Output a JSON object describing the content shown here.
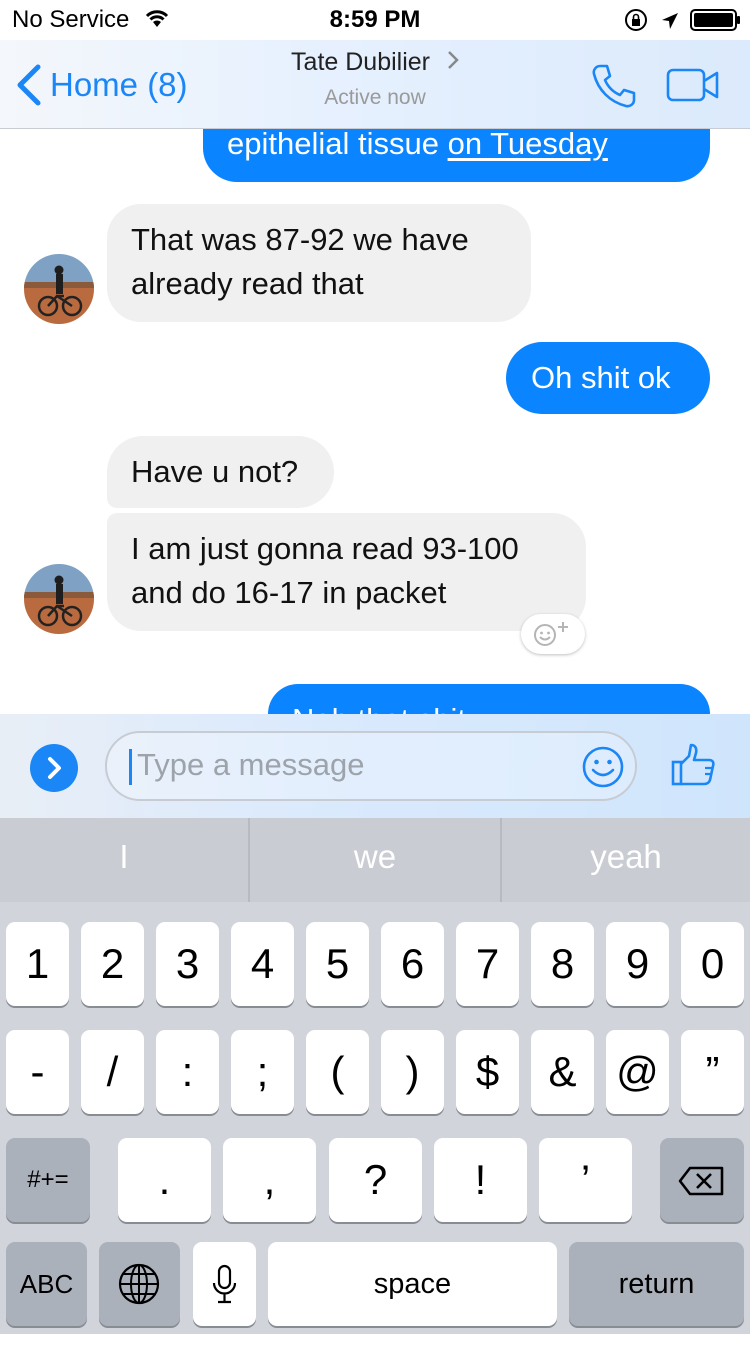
{
  "status_bar": {
    "carrier": "No Service",
    "time": "8:59 PM"
  },
  "nav": {
    "back_label": "Home (8)",
    "contact_name": "Tate Dubilier",
    "contact_status": "Active now"
  },
  "messages": {
    "msg1": {
      "text": "epithelial tissue ",
      "link": "on Tuesday"
    },
    "msg2": {
      "line1": "That was 87-92 we have",
      "line2": "already read that"
    },
    "msg3": {
      "text": "Oh shit ok"
    },
    "msg4": {
      "text": "Have u not?"
    },
    "msg5": {
      "line1": "I am just gonna read 93-100",
      "line2": "and do 16-17 in packet"
    },
    "msg6": {
      "text": "Nah that shit …"
    }
  },
  "composer": {
    "placeholder": "Type a message"
  },
  "keyboard": {
    "predictions": [
      "I",
      "we",
      "yeah"
    ],
    "row1": [
      "1",
      "2",
      "3",
      "4",
      "5",
      "6",
      "7",
      "8",
      "9",
      "0"
    ],
    "row2": [
      "-",
      "/",
      ":",
      ";",
      "(",
      ")",
      "$",
      "&",
      "@",
      "”"
    ],
    "row3_mode": "#+=",
    "row3": [
      ".",
      ",",
      "?",
      "!",
      "’"
    ],
    "abc": "ABC",
    "space": "space",
    "return": "return"
  },
  "colors": {
    "accent": "#1b86f5",
    "outgoing_bubble": "#0a84ff",
    "incoming_bubble": "#f1f0f0",
    "keyboard_bg": "#d1d5db"
  }
}
